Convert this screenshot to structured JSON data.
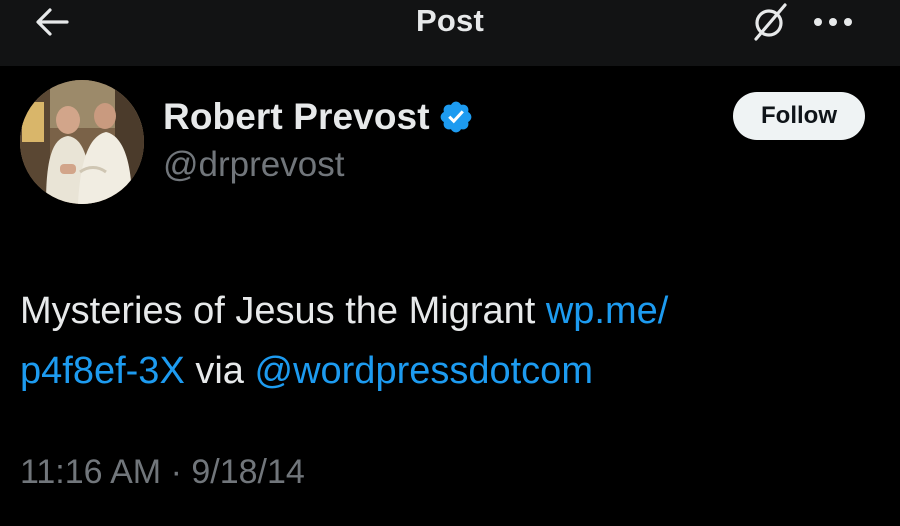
{
  "topbar": {
    "title": "Post",
    "back_icon": "arrow-left-icon",
    "grok_icon": "grok-icon",
    "more_icon": "more-horizontal-icon"
  },
  "author": {
    "display_name": "Robert Prevost",
    "handle": "@drprevost",
    "verified": true,
    "verified_color": "#1d9bf0"
  },
  "follow_button": {
    "label": "Follow"
  },
  "post": {
    "text_before": "Mysteries of Jesus the Migrant ",
    "link_url_part1": "wp.me/",
    "link_url_part2": "p4f8ef-3X",
    "text_via": " via ",
    "mention": "@wordpressdotcom",
    "link_color": "#1d9bf0"
  },
  "meta": {
    "time": "11:16 AM",
    "separator": " · ",
    "date": "9/18/14"
  },
  "colors": {
    "background": "#000000",
    "topbar": "#121314",
    "text_primary": "#e7e9ea",
    "text_secondary": "#71767b",
    "follow_bg": "#eff3f4"
  }
}
